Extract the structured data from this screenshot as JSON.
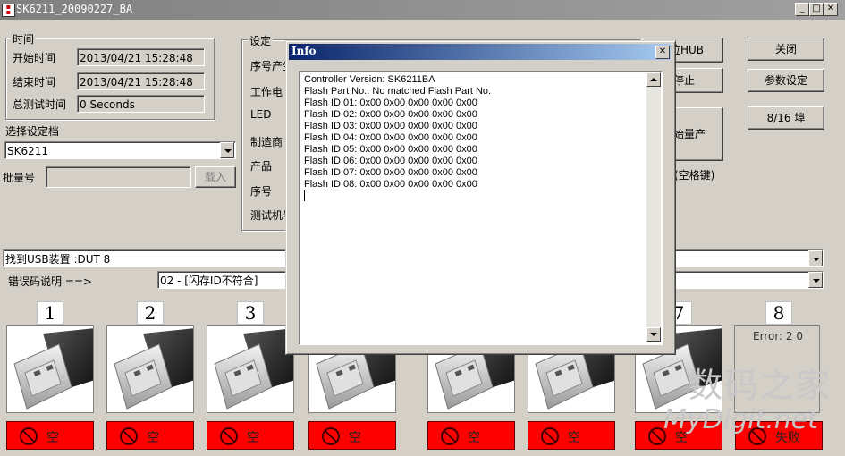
{
  "window": {
    "title": "SK6211_20090227_BA",
    "min": "_",
    "max": "□",
    "close": "✕"
  },
  "time_group": {
    "label": "时间",
    "start_label": "开始时间",
    "start_value": "2013/04/21 15:28:48",
    "end_label": "结束时间",
    "end_value": "2013/04/21 15:28:48",
    "total_label": "总测试时间",
    "total_value": "0 Seconds"
  },
  "profile": {
    "label": "选择设定档",
    "value": "SK6211",
    "batch_label": "批量号",
    "batch_value": "",
    "load_button": "载入"
  },
  "settings_group": {
    "label": "设定",
    "rows": [
      "序号产生",
      "工作电",
      "LED",
      "制造商",
      "产品",
      "序号",
      "测试机号"
    ]
  },
  "right_buttons": {
    "reset_hub": "位HUB",
    "stop": "停止",
    "start": "始量产",
    "space_hint": "(空格键)",
    "close": "关闭",
    "params": "参数设定",
    "ports": "8/16 埠"
  },
  "usb_status": {
    "value": "找到USB装置 :DUT 8"
  },
  "error_row": {
    "label": "错误码说明 ==>",
    "value": "02 - [闪存ID不符合]"
  },
  "slots": [
    {
      "num": "1",
      "status": "空"
    },
    {
      "num": "2",
      "status": "空"
    },
    {
      "num": "3",
      "status": "空"
    },
    {
      "num": "4",
      "status": "空"
    },
    {
      "num": "5",
      "status": "空"
    },
    {
      "num": "6",
      "status": "空"
    },
    {
      "num": "7",
      "status": "空"
    },
    {
      "num": "8",
      "status": "失败",
      "error": "Error: 2 0"
    }
  ],
  "info_dialog": {
    "title": "Info",
    "close": "✕",
    "lines": [
      "Controller Version: SK6211BA",
      "Flash Part No.: No matched Flash Part No.",
      "Flash ID 01: 0x00 0x00 0x00 0x00 0x00",
      "Flash ID 02: 0x00 0x00 0x00 0x00 0x00",
      "Flash ID 03: 0x00 0x00 0x00 0x00 0x00",
      "Flash ID 04: 0x00 0x00 0x00 0x00 0x00",
      "Flash ID 05: 0x00 0x00 0x00 0x00 0x00",
      "Flash ID 06: 0x00 0x00 0x00 0x00 0x00",
      "Flash ID 07: 0x00 0x00 0x00 0x00 0x00",
      "Flash ID 08: 0x00 0x00 0x00 0x00 0x00"
    ]
  },
  "watermark": {
    "cn": "数码之家",
    "en": "MyDigit.net"
  },
  "colors": {
    "title_active": "#0a246a",
    "title_inactive": "#808080",
    "fail_red": "#ff0000",
    "face": "#d4d0c8"
  }
}
